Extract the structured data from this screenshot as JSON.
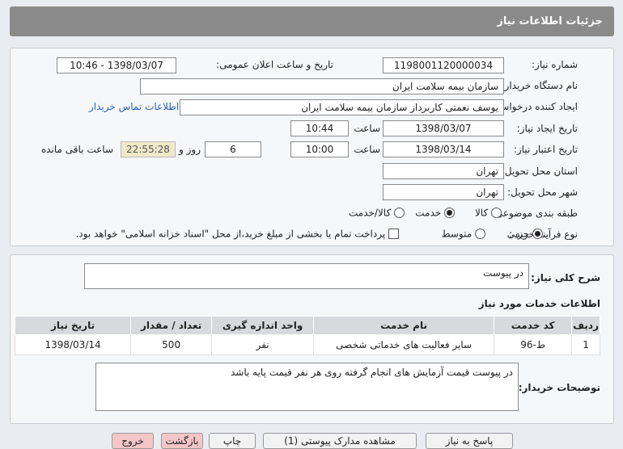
{
  "header": {
    "title": "جزئیات اطلاعات نیاز"
  },
  "form": {
    "need_number_label": "شماره نیاز:",
    "need_number": "1198001120000034",
    "announce_label": "تاریخ و ساعت اعلان عمومی:",
    "announce_value": "1398/03/07 - 10:46",
    "buyer_org_label": "نام دستگاه خریدار:",
    "buyer_org": "سازمان بیمه سلامت ایران",
    "requester_label": "ایجاد کننده درخواست:",
    "requester": "یوسف نعمتی کاربرداز سازمان بیمه سلامت ایران",
    "contact_link": "اطلاعات تماس خریدار",
    "created_date_label": "تاریخ ایجاد نیاز:",
    "created_date": "1398/03/07",
    "time_label": "ساعت",
    "created_time": "10:44",
    "validity_label": "تاریخ اعتبار نیاز:",
    "validity_date": "1398/03/14",
    "validity_time": "10:00",
    "days": "6",
    "days_label": "روز و",
    "remaining": "22:55:28",
    "remaining_label": "ساعت باقی مانده",
    "province_label": "استان محل تحویل:",
    "province": "تهران",
    "city_label": "شهر محل تحویل:",
    "city": "تهران",
    "category_label": "طبقه بندی موضوعی:",
    "category_options": [
      "کالا",
      "خدمت",
      "کالا/خدمت"
    ],
    "category_selected": "خدمت",
    "process_label": "نوع فرآیند خرید :",
    "process_options": [
      "جزیی",
      "متوسط"
    ],
    "process_selected": "جزیی",
    "payment_note": "پرداخت تمام یا بخشی از مبلغ خرید،از محل \"اسناد خزانه اسلامی\" خواهد بود."
  },
  "summary": {
    "label": "شرح کلی نیاز:",
    "value": "در پیوست"
  },
  "services": {
    "title": "اطلاعات خدمات مورد نیاز",
    "columns": [
      "ردیف",
      "کد خدمت",
      "نام خدمت",
      "واحد اندازه گیری",
      "تعداد / مقدار",
      "تاریخ نیاز"
    ],
    "rows": [
      [
        "1",
        "ط-96",
        "سایر فعالیت های خدماتی شخصی",
        "نفر",
        "500",
        "1398/03/14"
      ]
    ]
  },
  "buyer_notes": {
    "label": "توضیحات خریدار:",
    "value": "در پیوست قیمت آزمایش های انجام گرفته روی هر نفر قیمت پایه باشد"
  },
  "buttons": [
    "پاسخ به نیاز",
    "مشاهده مدارک پیوستی (1)",
    "چاپ",
    "بازگشت",
    "خروج"
  ]
}
